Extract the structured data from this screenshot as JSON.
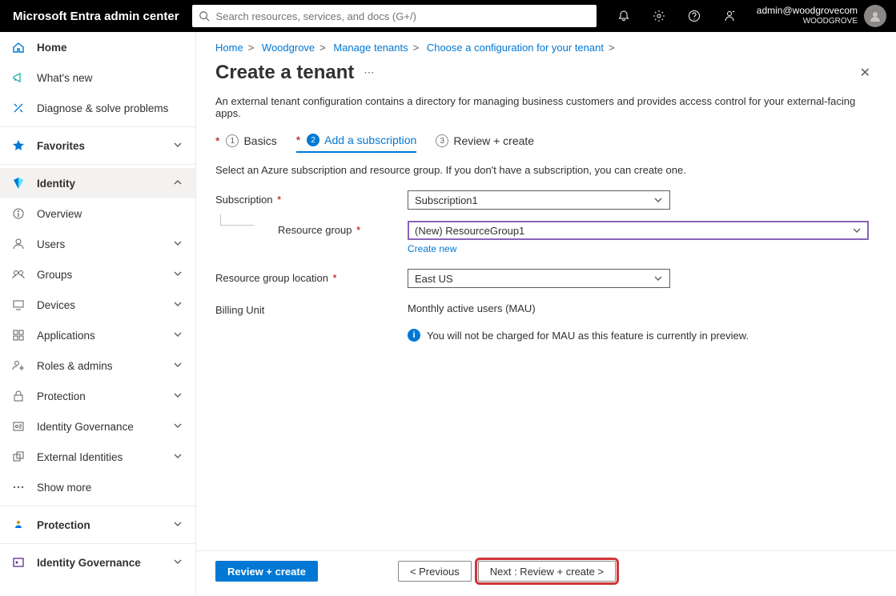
{
  "topbar": {
    "brand": "Microsoft Entra admin center",
    "search_placeholder": "Search resources, services, and docs (G+/)",
    "account_email": "admin@woodgrovecom",
    "tenant_name": "WOODGROVE"
  },
  "sidebar": {
    "home": "Home",
    "whats_new": "What's new",
    "diagnose": "Diagnose & solve problems",
    "favorites": "Favorites",
    "identity": "Identity",
    "identity_items": {
      "overview": "Overview",
      "users": "Users",
      "groups": "Groups",
      "devices": "Devices",
      "applications": "Applications",
      "roles": "Roles & admins",
      "protection": "Protection",
      "governance": "Identity Governance",
      "external": "External Identities",
      "show_more": "Show more"
    },
    "protection_section": "Protection",
    "governance_section": "Identity Governance"
  },
  "breadcrumbs": {
    "home": "Home",
    "wg": "Woodgrove",
    "manage": "Manage tenants",
    "choose": "Choose a configuration for your tenant"
  },
  "page_title": "Create a tenant",
  "description": "An external tenant configuration contains a directory for managing business customers and provides access control for your external-facing apps.",
  "tabs": {
    "basics": "Basics",
    "add_sub": "Add a subscription",
    "review": "Review + create"
  },
  "sub_desc": "Select an Azure subscription and resource group. If you don't have a subscription, you can create one.",
  "form": {
    "subscription_label": "Subscription",
    "subscription_value": "Subscription1",
    "rg_label": "Resource group",
    "rg_value": "(New) ResourceGroup1",
    "create_new_link": "Create new",
    "rg_loc_label": "Resource group location",
    "rg_loc_value": "East US",
    "billing_label": "Billing Unit",
    "billing_value": "Monthly active users (MAU)",
    "info_text": "You will not be charged for MAU as this feature is currently in preview."
  },
  "footer": {
    "review_create": "Review + create",
    "previous": "< Previous",
    "next": "Next : Review + create >"
  }
}
